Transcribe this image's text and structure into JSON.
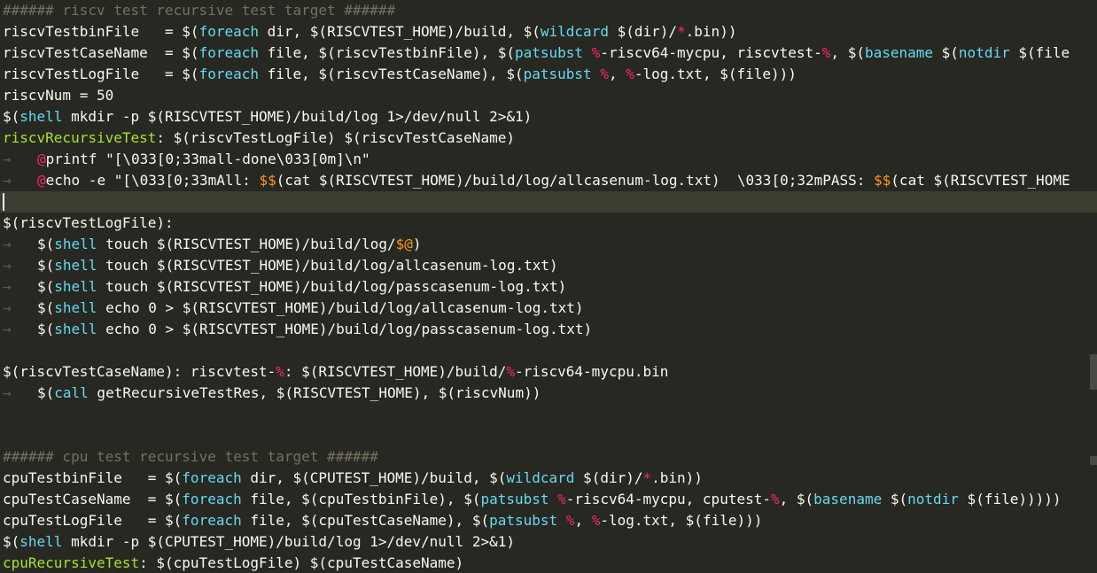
{
  "colors": {
    "background": "#272822",
    "current_line": "#3e3d32"
  },
  "editor": {
    "lines": [
      {
        "tokens": [
          {
            "text": "###### riscv test recursive test target ######",
            "c": "#75715e"
          }
        ]
      },
      {
        "tokens": [
          {
            "text": "riscvTestbinFile  ",
            "c": "#f8f8f2"
          },
          {
            "text": " = ",
            "c": "#f8f8f2"
          },
          {
            "text": "$(",
            "c": "#f8f8f2"
          },
          {
            "text": "foreach",
            "c": "#66d9ef"
          },
          {
            "text": " dir, ",
            "c": "#f8f8f2"
          },
          {
            "text": "$(RISCVTEST_HOME)/build, ",
            "c": "#f8f8f2"
          },
          {
            "text": "$(",
            "c": "#f8f8f2"
          },
          {
            "text": "wildcard",
            "c": "#66d9ef"
          },
          {
            "text": " $(dir)/",
            "c": "#f8f8f2"
          },
          {
            "text": "*",
            "c": "#f92672"
          },
          {
            "text": ".bin))",
            "c": "#f8f8f2"
          }
        ]
      },
      {
        "tokens": [
          {
            "text": "riscvTestCaseName ",
            "c": "#f8f8f2"
          },
          {
            "text": " = ",
            "c": "#f8f8f2"
          },
          {
            "text": "$(",
            "c": "#f8f8f2"
          },
          {
            "text": "foreach",
            "c": "#66d9ef"
          },
          {
            "text": " file, $(riscvTestbinFile), $(",
            "c": "#f8f8f2"
          },
          {
            "text": "patsubst",
            "c": "#66d9ef"
          },
          {
            "text": " ",
            "c": "#f8f8f2"
          },
          {
            "text": "%",
            "c": "#f92672"
          },
          {
            "text": "-riscv64-mycpu, riscvtest-",
            "c": "#f8f8f2"
          },
          {
            "text": "%",
            "c": "#f92672"
          },
          {
            "text": ", $(",
            "c": "#f8f8f2"
          },
          {
            "text": "basename",
            "c": "#66d9ef"
          },
          {
            "text": " $(",
            "c": "#f8f8f2"
          },
          {
            "text": "notdir",
            "c": "#66d9ef"
          },
          {
            "text": " $(file",
            "c": "#f8f8f2"
          }
        ]
      },
      {
        "tokens": [
          {
            "text": "riscvTestLogFile  ",
            "c": "#f8f8f2"
          },
          {
            "text": " = ",
            "c": "#f8f8f2"
          },
          {
            "text": "$(",
            "c": "#f8f8f2"
          },
          {
            "text": "foreach",
            "c": "#66d9ef"
          },
          {
            "text": " file, $(riscvTestCaseName), $(",
            "c": "#f8f8f2"
          },
          {
            "text": "patsubst",
            "c": "#66d9ef"
          },
          {
            "text": " ",
            "c": "#f8f8f2"
          },
          {
            "text": "%",
            "c": "#f92672"
          },
          {
            "text": ", ",
            "c": "#f8f8f2"
          },
          {
            "text": "%",
            "c": "#f92672"
          },
          {
            "text": "-log.txt, $(file)))",
            "c": "#f8f8f2"
          }
        ]
      },
      {
        "tokens": [
          {
            "text": "riscvNum = 50",
            "c": "#f8f8f2"
          }
        ]
      },
      {
        "tokens": [
          {
            "text": "$(",
            "c": "#f8f8f2"
          },
          {
            "text": "shell",
            "c": "#66d9ef"
          },
          {
            "text": " mkdir -p $(RISCVTEST_HOME)/build/log 1>/dev/null 2>&1)",
            "c": "#f8f8f2"
          }
        ]
      },
      {
        "tokens": [
          {
            "text": "riscvRecursiveTest",
            "c": "#a6e22e"
          },
          {
            "text": ": $(riscvTestLogFile) $(riscvTestCaseName)",
            "c": "#f8f8f2"
          }
        ]
      },
      {
        "tab": true,
        "tokens": [
          {
            "text": "@",
            "c": "#f92672"
          },
          {
            "text": "printf \"[\\033[0;33mall-done\\033[0m]\\n\"",
            "c": "#f8f8f2"
          }
        ]
      },
      {
        "tab": true,
        "tokens": [
          {
            "text": "@",
            "c": "#f92672"
          },
          {
            "text": "echo -e \"[\\033[0;33mAll: ",
            "c": "#f8f8f2"
          },
          {
            "text": "$$",
            "c": "#fd971f"
          },
          {
            "text": "(cat $(RISCVTEST_HOME)/build/log/allcasenum-log.txt)  \\033[0;32mPASS: ",
            "c": "#f8f8f2"
          },
          {
            "text": "$$",
            "c": "#fd971f"
          },
          {
            "text": "(cat $(RISCVTEST_HOME",
            "c": "#f8f8f2"
          }
        ]
      },
      {
        "current": true,
        "tokens": []
      },
      {
        "tokens": [
          {
            "text": "$(riscvTestLogFile):",
            "c": "#f8f8f2"
          }
        ]
      },
      {
        "tab": true,
        "tokens": [
          {
            "text": "$(",
            "c": "#f8f8f2"
          },
          {
            "text": "shell",
            "c": "#66d9ef"
          },
          {
            "text": " touch $(RISCVTEST_HOME)/build/log/",
            "c": "#f8f8f2"
          },
          {
            "text": "$@",
            "c": "#fd971f"
          },
          {
            "text": ")",
            "c": "#f8f8f2"
          }
        ]
      },
      {
        "tab": true,
        "tokens": [
          {
            "text": "$(",
            "c": "#f8f8f2"
          },
          {
            "text": "shell",
            "c": "#66d9ef"
          },
          {
            "text": " touch $(RISCVTEST_HOME)/build/log/allcasenum-log.txt)",
            "c": "#f8f8f2"
          }
        ]
      },
      {
        "tab": true,
        "tokens": [
          {
            "text": "$(",
            "c": "#f8f8f2"
          },
          {
            "text": "shell",
            "c": "#66d9ef"
          },
          {
            "text": " touch $(RISCVTEST_HOME)/build/log/passcasenum-log.txt)",
            "c": "#f8f8f2"
          }
        ]
      },
      {
        "tab": true,
        "tokens": [
          {
            "text": "$(",
            "c": "#f8f8f2"
          },
          {
            "text": "shell",
            "c": "#66d9ef"
          },
          {
            "text": " echo 0 > $(RISCVTEST_HOME)/build/log/allcasenum-log.txt)",
            "c": "#f8f8f2"
          }
        ]
      },
      {
        "tab": true,
        "tokens": [
          {
            "text": "$(",
            "c": "#f8f8f2"
          },
          {
            "text": "shell",
            "c": "#66d9ef"
          },
          {
            "text": " echo 0 > $(RISCVTEST_HOME)/build/log/passcasenum-log.txt)",
            "c": "#f8f8f2"
          }
        ]
      },
      {
        "tokens": []
      },
      {
        "tokens": [
          {
            "text": "$(riscvTestCaseName): riscvtest-",
            "c": "#f8f8f2"
          },
          {
            "text": "%",
            "c": "#f92672"
          },
          {
            "text": ": $(RISCVTEST_HOME)/build/",
            "c": "#f8f8f2"
          },
          {
            "text": "%",
            "c": "#f92672"
          },
          {
            "text": "-riscv64-mycpu.bin",
            "c": "#f8f8f2"
          }
        ]
      },
      {
        "tab": true,
        "tokens": [
          {
            "text": "$(",
            "c": "#f8f8f2"
          },
          {
            "text": "call",
            "c": "#66d9ef"
          },
          {
            "text": " getRecursiveTestRes, $(RISCVTEST_HOME), $(riscvNum))",
            "c": "#f8f8f2"
          }
        ]
      },
      {
        "tokens": []
      },
      {
        "tokens": []
      },
      {
        "tokens": [
          {
            "text": "###### cpu test recursive test target ######",
            "c": "#75715e"
          }
        ]
      },
      {
        "tokens": [
          {
            "text": "cpuTestbinFile  ",
            "c": "#f8f8f2"
          },
          {
            "text": " = ",
            "c": "#f8f8f2"
          },
          {
            "text": "$(",
            "c": "#f8f8f2"
          },
          {
            "text": "foreach",
            "c": "#66d9ef"
          },
          {
            "text": " dir, $(CPUTEST_HOME)/build, $(",
            "c": "#f8f8f2"
          },
          {
            "text": "wildcard",
            "c": "#66d9ef"
          },
          {
            "text": " $(dir)/",
            "c": "#f8f8f2"
          },
          {
            "text": "*",
            "c": "#f92672"
          },
          {
            "text": ".bin))",
            "c": "#f8f8f2"
          }
        ]
      },
      {
        "tokens": [
          {
            "text": "cpuTestCaseName ",
            "c": "#f8f8f2"
          },
          {
            "text": " = ",
            "c": "#f8f8f2"
          },
          {
            "text": "$(",
            "c": "#f8f8f2"
          },
          {
            "text": "foreach",
            "c": "#66d9ef"
          },
          {
            "text": " file, $(cpuTestbinFile), $(",
            "c": "#f8f8f2"
          },
          {
            "text": "patsubst",
            "c": "#66d9ef"
          },
          {
            "text": " ",
            "c": "#f8f8f2"
          },
          {
            "text": "%",
            "c": "#f92672"
          },
          {
            "text": "-riscv64-mycpu, cputest-",
            "c": "#f8f8f2"
          },
          {
            "text": "%",
            "c": "#f92672"
          },
          {
            "text": ", $(",
            "c": "#f8f8f2"
          },
          {
            "text": "basename",
            "c": "#66d9ef"
          },
          {
            "text": " $(",
            "c": "#f8f8f2"
          },
          {
            "text": "notdir",
            "c": "#66d9ef"
          },
          {
            "text": " $(file)))))",
            "c": "#f8f8f2"
          }
        ]
      },
      {
        "tokens": [
          {
            "text": "cpuTestLogFile  ",
            "c": "#f8f8f2"
          },
          {
            "text": " = ",
            "c": "#f8f8f2"
          },
          {
            "text": "$(",
            "c": "#f8f8f2"
          },
          {
            "text": "foreach",
            "c": "#66d9ef"
          },
          {
            "text": " file, $(cpuTestCaseName), $(",
            "c": "#f8f8f2"
          },
          {
            "text": "patsubst",
            "c": "#66d9ef"
          },
          {
            "text": " ",
            "c": "#f8f8f2"
          },
          {
            "text": "%",
            "c": "#f92672"
          },
          {
            "text": ", ",
            "c": "#f8f8f2"
          },
          {
            "text": "%",
            "c": "#f92672"
          },
          {
            "text": "-log.txt, $(file)))",
            "c": "#f8f8f2"
          }
        ]
      },
      {
        "tokens": [
          {
            "text": "$(",
            "c": "#f8f8f2"
          },
          {
            "text": "shell",
            "c": "#66d9ef"
          },
          {
            "text": " mkdir -p $(CPUTEST_HOME)/build/log 1>/dev/null 2>&1)",
            "c": "#f8f8f2"
          }
        ]
      },
      {
        "tokens": [
          {
            "text": "cpuRecursiveTest",
            "c": "#a6e22e"
          },
          {
            "text": ": $(cpuTestLogFile) $(cpuTestCaseName)",
            "c": "#f8f8f2"
          }
        ]
      }
    ]
  }
}
